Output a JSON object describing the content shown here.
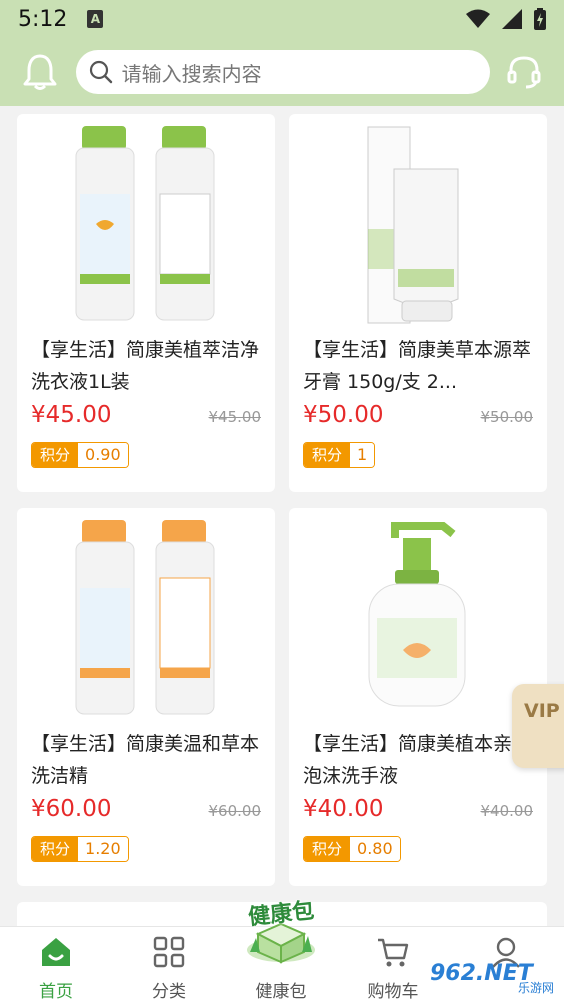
{
  "status_bar": {
    "time": "5:12",
    "notification_icon": "A"
  },
  "header": {
    "search_placeholder": "请输入搜索内容"
  },
  "products": [
    {
      "name": "【享生活】简康美植萃洁净洗衣液1L装",
      "price": "¥45.00",
      "original_price": "¥45.00",
      "points_label": "积分",
      "points": "0.90"
    },
    {
      "name": "【享生活】简康美草本源萃牙膏 150g/支 2...",
      "price": "¥50.00",
      "original_price": "¥50.00",
      "points_label": "积分",
      "points": "1"
    },
    {
      "name": "【享生活】简康美温和草本洗洁精",
      "price": "¥60.00",
      "original_price": "¥60.00",
      "points_label": "积分",
      "points": "1.20"
    },
    {
      "name": "【享生活】简康美植本亲肤泡沫洗手液",
      "price": "¥40.00",
      "original_price": "¥40.00",
      "points_label": "积分",
      "points": "0.80"
    }
  ],
  "vip_badge": "VIP",
  "tabbar": {
    "home": "首页",
    "category": "分类",
    "health": "健康包",
    "health_badge": "健康包",
    "cart": "购物车",
    "mine": ""
  },
  "watermark": {
    "logo": "962.NET",
    "sub": "乐游网"
  },
  "colors": {
    "header_bg": "#c9e0b4",
    "price": "#e62a2a",
    "points": "#f39800",
    "tab_active": "#3aa142"
  }
}
